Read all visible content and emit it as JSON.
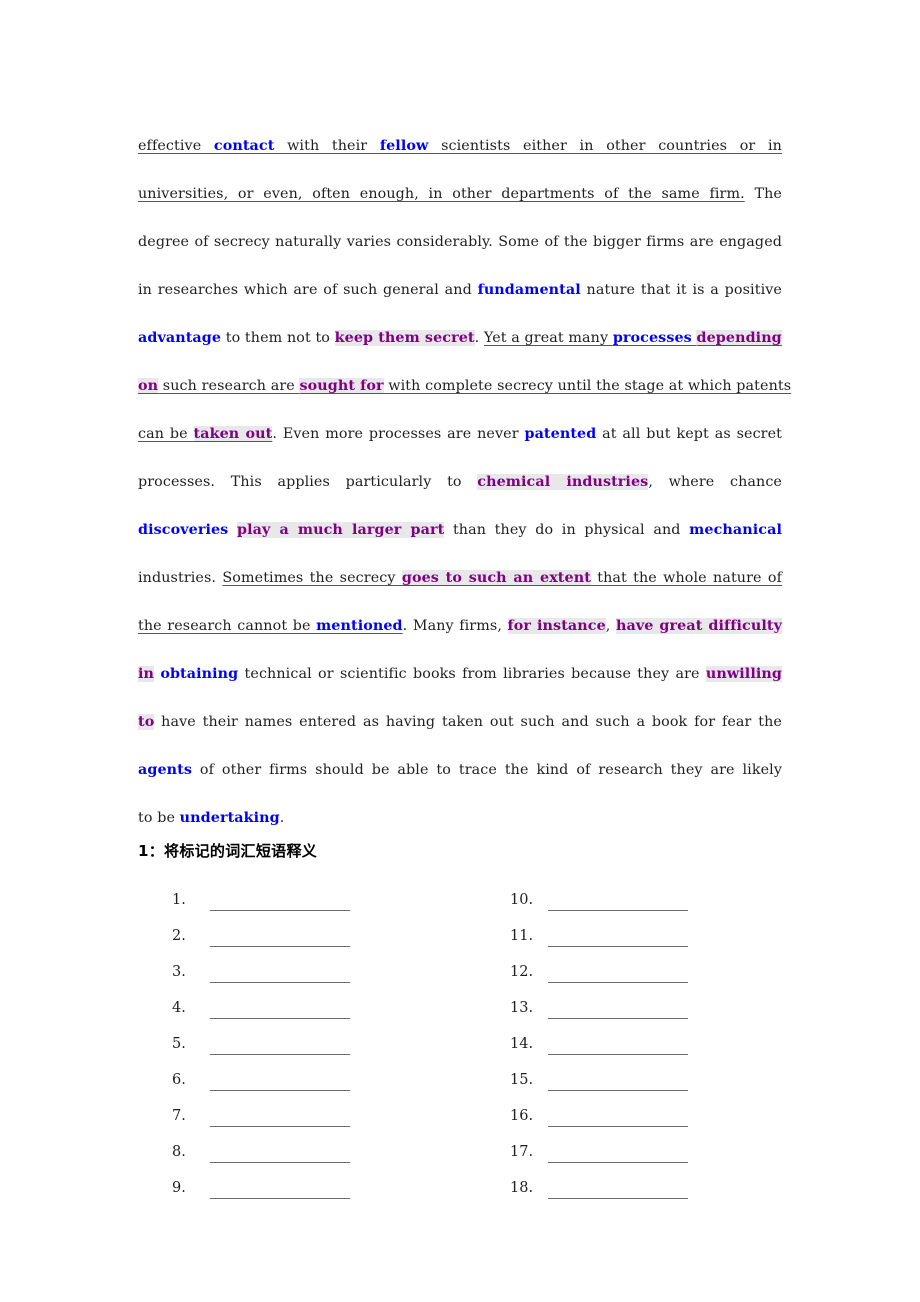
{
  "document": {
    "passage_lines": [
      {
        "id": "line-1",
        "segments": [
          {
            "text": "effective ",
            "style": "underline"
          },
          {
            "text": "contact",
            "style": "blue-underline"
          },
          {
            "text": " with their ",
            "style": "underline"
          },
          {
            "text": "fellow",
            "style": "blue-underline"
          },
          {
            "text": " scientists either in other countries or in",
            "style": "underline"
          }
        ]
      },
      {
        "id": "line-2",
        "segments": [
          {
            "text": "universities, or even, often enough, in other departments of the same firm.",
            "style": "underline"
          },
          {
            "text": " The",
            "style": "plain"
          }
        ]
      },
      {
        "id": "line-3",
        "segments": [
          {
            "text": "degree of secrecy naturally varies considerably. Some of the bigger firms are engaged",
            "style": "plain"
          }
        ]
      },
      {
        "id": "line-4",
        "segments": [
          {
            "text": "in researches which are of such general and ",
            "style": "plain"
          },
          {
            "text": "fundamental",
            "style": "blue"
          },
          {
            "text": " nature that it is a positive",
            "style": "plain"
          }
        ]
      },
      {
        "id": "line-5",
        "segments": [
          {
            "text": "advantage",
            "style": "blue"
          },
          {
            "text": " to them not to ",
            "style": "plain"
          },
          {
            "text": "keep them secret",
            "style": "purple"
          },
          {
            "text": ". ",
            "style": "plain"
          },
          {
            "text": "Yet a great many ",
            "style": "underline"
          },
          {
            "text": "processes",
            "style": "blue-underline"
          },
          {
            "text": " ",
            "style": "underline"
          },
          {
            "text": "depending",
            "style": "purple-underline"
          }
        ]
      },
      {
        "id": "line-6",
        "segments": [
          {
            "text": "on",
            "style": "purple-underline"
          },
          {
            "text": " such research are ",
            "style": "underline"
          },
          {
            "text": "sought for",
            "style": "purple-underline"
          },
          {
            "text": " with complete secrecy until the stage at which patents",
            "style": "underline"
          }
        ]
      },
      {
        "id": "line-7",
        "segments": [
          {
            "text": "can be ",
            "style": "underline"
          },
          {
            "text": "taken out",
            "style": "purple-underline"
          },
          {
            "text": ". Even more processes are never ",
            "style": "plain"
          },
          {
            "text": "patented",
            "style": "blue"
          },
          {
            "text": " at all but kept as secret",
            "style": "plain"
          }
        ]
      },
      {
        "id": "line-8",
        "segments": [
          {
            "text": "processes. This applies particularly to ",
            "style": "plain"
          },
          {
            "text": "chemical industries",
            "style": "purple"
          },
          {
            "text": ", where chance",
            "style": "plain"
          }
        ]
      },
      {
        "id": "line-9",
        "segments": [
          {
            "text": "discoveries",
            "style": "blue"
          },
          {
            "text": " ",
            "style": "plain"
          },
          {
            "text": "play a much larger part",
            "style": "purple"
          },
          {
            "text": " than they do in physical and ",
            "style": "plain"
          },
          {
            "text": "mechanical",
            "style": "blue"
          }
        ]
      },
      {
        "id": "line-10",
        "segments": [
          {
            "text": "industries. ",
            "style": "plain"
          },
          {
            "text": "Sometimes the secrecy ",
            "style": "underline"
          },
          {
            "text": "goes to such an extent",
            "style": "purple-underline"
          },
          {
            "text": " that the whole nature of",
            "style": "underline"
          }
        ]
      },
      {
        "id": "line-11",
        "segments": [
          {
            "text": "the research cannot be ",
            "style": "underline"
          },
          {
            "text": "mentioned",
            "style": "blue-underline"
          },
          {
            "text": ". Many firms, ",
            "style": "plain"
          },
          {
            "text": "for instance",
            "style": "purple"
          },
          {
            "text": ", ",
            "style": "plain"
          },
          {
            "text": "have great difficulty",
            "style": "purple"
          }
        ]
      },
      {
        "id": "line-12",
        "segments": [
          {
            "text": "in",
            "style": "purple"
          },
          {
            "text": " ",
            "style": "plain"
          },
          {
            "text": "obtaining",
            "style": "blue"
          },
          {
            "text": " technical or scientific books from libraries because they are ",
            "style": "plain"
          },
          {
            "text": "unwilling",
            "style": "purple"
          }
        ]
      },
      {
        "id": "line-13",
        "segments": [
          {
            "text": "to",
            "style": "purple"
          },
          {
            "text": " have their names entered as having taken out such and such a book for fear the",
            "style": "plain"
          }
        ]
      },
      {
        "id": "line-14",
        "segments": [
          {
            "text": "agents",
            "style": "blue"
          },
          {
            "text": " of other firms should be able to trace the kind of research they are likely",
            "style": "plain"
          }
        ]
      },
      {
        "id": "line-15",
        "segments": [
          {
            "text": "to be ",
            "style": "plain"
          },
          {
            "text": "undertaking",
            "style": "blue"
          },
          {
            "text": ".",
            "style": "plain"
          }
        ]
      }
    ],
    "exercise": {
      "heading": "1：将标记的词汇短语释义",
      "left_column": [
        {
          "number": "1.",
          "answer": ""
        },
        {
          "number": "2.",
          "answer": ""
        },
        {
          "number": "3.",
          "answer": ""
        },
        {
          "number": "4.",
          "answer": ""
        },
        {
          "number": "5.",
          "answer": ""
        },
        {
          "number": "6.",
          "answer": ""
        },
        {
          "number": "7.",
          "answer": ""
        },
        {
          "number": "8.",
          "answer": ""
        },
        {
          "number": "9.",
          "answer": ""
        }
      ],
      "right_column": [
        {
          "number": "10.",
          "answer": ""
        },
        {
          "number": "11.",
          "answer": ""
        },
        {
          "number": "12.",
          "answer": ""
        },
        {
          "number": "13.",
          "answer": ""
        },
        {
          "number": "14.",
          "answer": ""
        },
        {
          "number": "15.",
          "answer": ""
        },
        {
          "number": "16.",
          "answer": ""
        },
        {
          "number": "17.",
          "answer": ""
        },
        {
          "number": "18.",
          "answer": ""
        }
      ]
    },
    "colors": {
      "blue_term": "#0000ff",
      "purple_term": "#800080",
      "highlight_background": "#e8e7ea",
      "body_text": "#1f1f1f",
      "blank_rule": "#6b6b6b"
    }
  }
}
